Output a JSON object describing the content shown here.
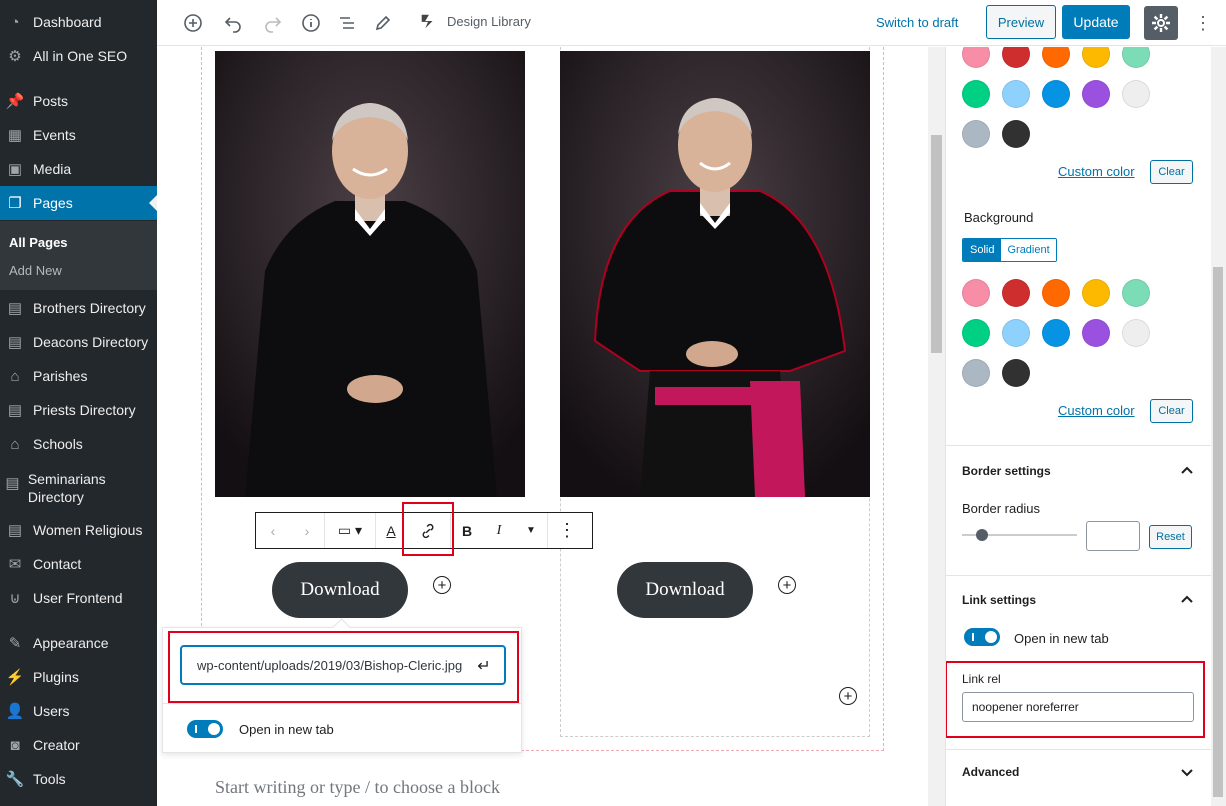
{
  "admin_menu": {
    "items": [
      {
        "label": "Dashboard",
        "icon": "dashboard-icon"
      },
      {
        "label": "All in One SEO",
        "icon": "gear-icon"
      },
      {
        "label": "Posts",
        "icon": "pin-icon"
      },
      {
        "label": "Events",
        "icon": "calendar-icon"
      },
      {
        "label": "Media",
        "icon": "media-icon"
      },
      {
        "label": "Pages",
        "icon": "pages-icon"
      },
      {
        "label": "Brothers Directory",
        "icon": "directory-icon"
      },
      {
        "label": "Deacons Directory",
        "icon": "directory-icon"
      },
      {
        "label": "Parishes",
        "icon": "home-icon"
      },
      {
        "label": "Priests Directory",
        "icon": "directory-icon"
      },
      {
        "label": "Schools",
        "icon": "home-icon"
      },
      {
        "label": "Seminarians Directory",
        "icon": "directory-icon"
      },
      {
        "label": "Women Religious",
        "icon": "directory-icon"
      },
      {
        "label": "Contact",
        "icon": "mail-icon"
      },
      {
        "label": "User Frontend",
        "icon": "frontend-icon"
      },
      {
        "label": "Appearance",
        "icon": "brush-icon"
      },
      {
        "label": "Plugins",
        "icon": "plugin-icon"
      },
      {
        "label": "Users",
        "icon": "user-icon"
      },
      {
        "label": "Creator",
        "icon": "creator-icon"
      },
      {
        "label": "Tools",
        "icon": "wrench-icon"
      }
    ],
    "submenu": [
      "All Pages",
      "Add New"
    ]
  },
  "toolbar": {
    "design_library": "Design Library",
    "switch_to_draft": "Switch to draft",
    "preview": "Preview",
    "update": "Update"
  },
  "editor": {
    "download_label_1": "Download",
    "download_label_2": "Download",
    "link_url": "wp-content/uploads/2019/03/Bishop-Cleric.jpg",
    "open_new_tab": "Open in new tab",
    "placeholder": "Start writing or type / to choose a block"
  },
  "sidebar": {
    "custom_color": "Custom color",
    "clear": "Clear",
    "background_label": "Background",
    "solid": "Solid",
    "gradient": "Gradient",
    "border_settings": "Border settings",
    "border_radius": "Border radius",
    "reset": "Reset",
    "link_settings": "Link settings",
    "open_new_tab": "Open in new tab",
    "link_rel": "Link rel",
    "link_rel_value": "noopener noreferrer",
    "advanced": "Advanced"
  },
  "colors": {
    "swatches": [
      "#f78da7",
      "#cf2e2e",
      "#ff6900",
      "#fcb900",
      "#7bdcb5",
      "#00d084",
      "#8ed1fc",
      "#0693e3",
      "#9b51e0",
      "#eeeeee",
      "#abb8c3",
      "#313131"
    ],
    "accent": "#007cba",
    "admin_bg": "#23282d",
    "highlight": "#e0001b"
  }
}
